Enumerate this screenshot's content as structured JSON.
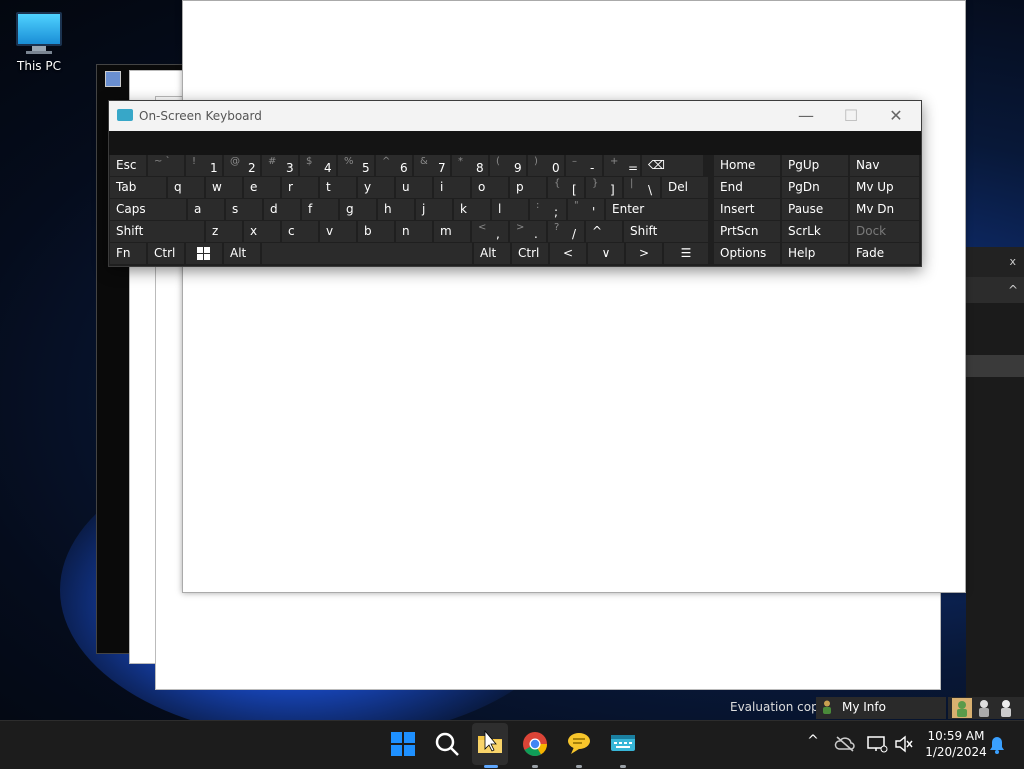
{
  "desktop": {
    "icon_label": "This PC"
  },
  "osk": {
    "title": "On-Screen Keyboard",
    "controls": {
      "minimize": "—",
      "maximize": "☐",
      "close": "✕"
    },
    "row1": [
      {
        "lbl": "Esc"
      },
      {
        "sec": "~ `"
      },
      {
        "sec": "!",
        "pri": "1"
      },
      {
        "sec": "@",
        "pri": "2"
      },
      {
        "sec": "#",
        "pri": "3"
      },
      {
        "sec": "$",
        "pri": "4"
      },
      {
        "sec": "%",
        "pri": "5"
      },
      {
        "sec": "^",
        "pri": "6"
      },
      {
        "sec": "&",
        "pri": "7"
      },
      {
        "sec": "*",
        "pri": "8"
      },
      {
        "sec": "(",
        "pri": "9"
      },
      {
        "sec": ")",
        "pri": "0"
      },
      {
        "sec": "–",
        "pri": "-"
      },
      {
        "sec": "+",
        "pri": "="
      },
      {
        "lbl": "⌫"
      }
    ],
    "row2": [
      "Tab",
      "q",
      "w",
      "e",
      "r",
      "t",
      "y",
      "u",
      "i",
      "o",
      "p"
    ],
    "row2_br": [
      {
        "sec": "{",
        "pri": "["
      },
      {
        "sec": "}",
        "pri": "]"
      },
      {
        "sec": "|",
        "pri": "\\"
      }
    ],
    "row2_del": "Del",
    "row3": [
      "Caps",
      "a",
      "s",
      "d",
      "f",
      "g",
      "h",
      "j",
      "k",
      "l"
    ],
    "row3_punct": [
      {
        "sec": ":",
        "pri": ";"
      },
      {
        "sec": "\"",
        "pri": "'"
      }
    ],
    "row3_enter": "Enter",
    "row4": [
      "Shift",
      "z",
      "x",
      "c",
      "v",
      "b",
      "n",
      "m"
    ],
    "row4_punct": [
      {
        "sec": "<",
        "pri": ","
      },
      {
        "sec": ">",
        "pri": "."
      },
      {
        "sec": "?",
        "pri": "/"
      }
    ],
    "row4_up": "^",
    "row4_shift": "Shift",
    "row5": {
      "fn": "Fn",
      "ctrl": "Ctrl",
      "win": "",
      "alt": "Alt",
      "alt2": "Alt",
      "ctrl2": "Ctrl",
      "left": "<",
      "down": "∨",
      "right": ">",
      "menu": "☰"
    },
    "nav": [
      [
        "Home",
        "PgUp",
        "Nav"
      ],
      [
        "End",
        "PgDn",
        "Mv Up"
      ],
      [
        "Insert",
        "Pause",
        "Mv Dn"
      ],
      [
        "PrtScn",
        "ScrLk",
        "Dock"
      ],
      [
        "Options",
        "Help",
        "Fade"
      ]
    ]
  },
  "right_panel": {
    "close": "x",
    "chevron": "^"
  },
  "eval": {
    "text": "Evaluation copy",
    "myinfo": "My Info"
  },
  "taskbar": {
    "clock_time": "10:59 AM",
    "clock_date": "1/20/2024",
    "tray_chevron": "^"
  },
  "colors": {
    "taskbar": "#1c1c1c",
    "osk_bg": "#1f1f1f",
    "key": "#2b2b2b",
    "accent": "#0a84ff"
  }
}
